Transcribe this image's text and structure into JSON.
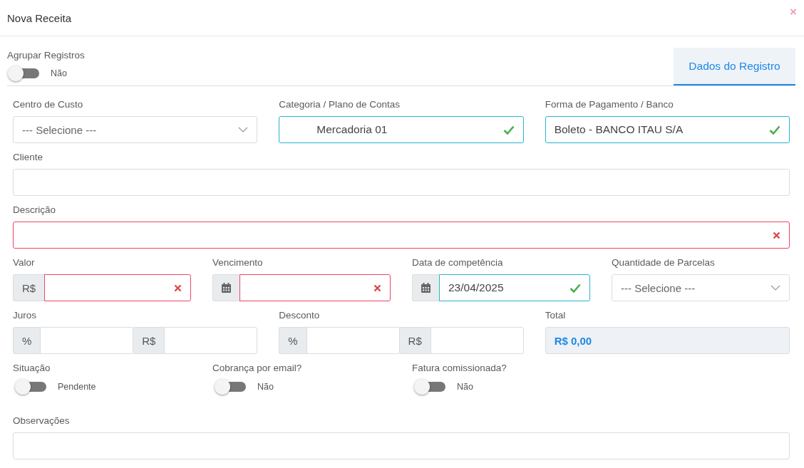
{
  "dialog": {
    "title": "Nova Receita",
    "close": "×"
  },
  "group_toggle": {
    "label": "Agrupar Registros",
    "on": false,
    "state_text": "Não"
  },
  "tabs": [
    {
      "label": "Dados do Registro",
      "selected": true
    }
  ],
  "rows": [
    {
      "kind": "thirds",
      "fields": [
        {
          "kind": "select",
          "label": "Centro de Custo",
          "placeholder": "--- Selecione ---"
        },
        {
          "kind": "input",
          "label": "Categoria / Plano de Contas",
          "parts": [
            {
              "value": "Mercadoria 01",
              "valid": true
            }
          ]
        },
        {
          "kind": "input",
          "label": "Forma de Pagamento / Banco",
          "parts": [
            {
              "value": "Boleto - BANCO ITAU S/A",
              "valid": true
            }
          ]
        }
      ]
    },
    {
      "kind": "full",
      "fields": [
        {
          "kind": "input",
          "label": "Cliente"
        }
      ]
    },
    {
      "kind": "full",
      "fields": [
        {
          "kind": "input",
          "label": "Descrição",
          "parts": [
            {
              "valid": false
            }
          ]
        }
      ]
    },
    {
      "kind": "quarters",
      "fields": [
        {
          "kind": "input",
          "label": "Valor",
          "parts": [
            {
              "prefix": {
                "kind": "text",
                "text": "R$"
              },
              "valid": false
            }
          ]
        },
        {
          "kind": "input",
          "label": "Vencimento",
          "parts": [
            {
              "prefix": {
                "kind": "calendar"
              },
              "valid": false
            }
          ]
        },
        {
          "kind": "input",
          "label": "Data de competência",
          "parts": [
            {
              "prefix": {
                "kind": "calendar"
              },
              "value": "23/04/2025",
              "valid": true
            }
          ]
        },
        {
          "kind": "select",
          "label": "Quantidade de Parcelas",
          "placeholder": "--- Selecione ---"
        }
      ]
    },
    {
      "kind": "thirds",
      "fields": [
        {
          "kind": "input",
          "label": "Juros",
          "parts": [
            {
              "prefix": {
                "kind": "text",
                "text": "%"
              }
            },
            {
              "prefix": {
                "kind": "text",
                "text": "R$"
              }
            }
          ]
        },
        {
          "kind": "input",
          "label": "Desconto",
          "parts": [
            {
              "prefix": {
                "kind": "text",
                "text": "%"
              }
            },
            {
              "prefix": {
                "kind": "text",
                "text": "R$"
              }
            }
          ]
        },
        {
          "kind": "total",
          "label": "Total",
          "value": "R$ 0,00"
        }
      ]
    }
  ],
  "switches": [
    {
      "label": "Situação",
      "on": false,
      "state_text": "Pendente"
    },
    {
      "label": "Cobrança por email?",
      "on": false,
      "state_text": "Não"
    },
    {
      "label": "Fatura comissionada?",
      "on": false,
      "state_text": "Não"
    }
  ],
  "notes": {
    "label": "Observações"
  }
}
